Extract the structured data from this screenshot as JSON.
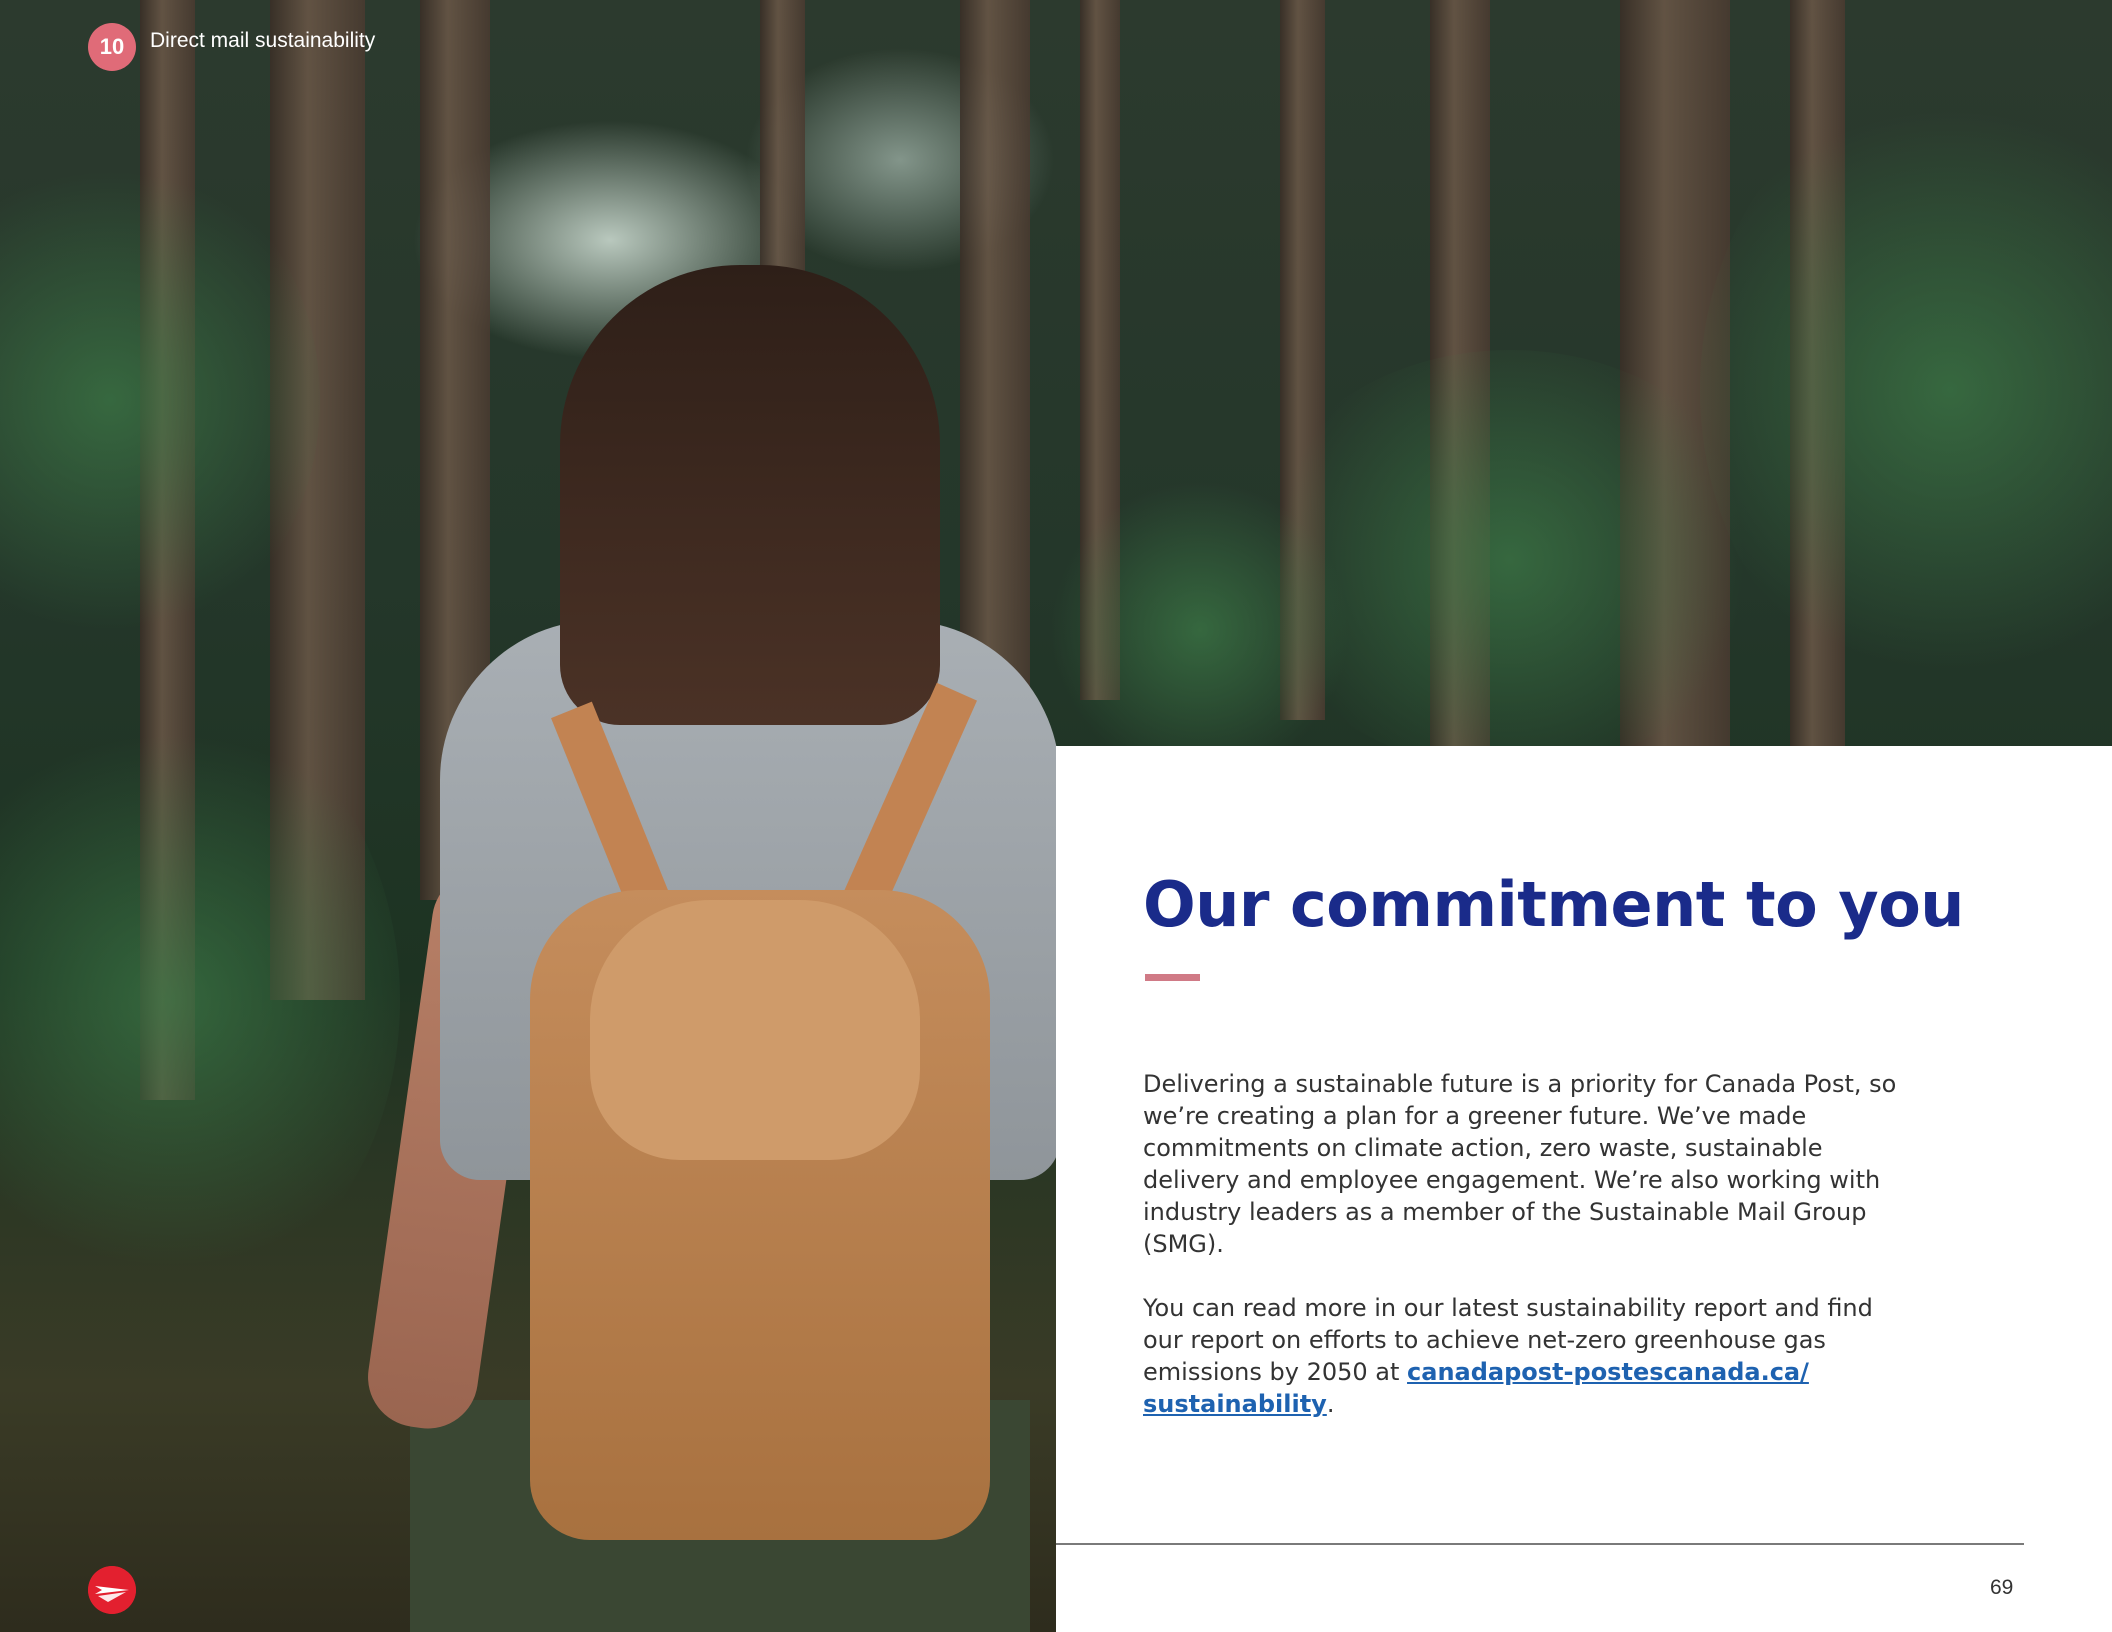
{
  "header": {
    "chapter_number": "10",
    "section_title": "Direct mail sustainability"
  },
  "main": {
    "title": "Our commitment to you",
    "paragraph_1": "Delivering a sustainable future is a priority for Canada Post, so we’re creating a plan for a greener future. We’ve made commitments on climate action, zero waste, sustainable delivery and employee engagement. We’re also working with industry leaders as a member of the Sustainable Mail Group (SMG).",
    "paragraph_2_before_link": "You can read more in our latest sustainability report and find our report on efforts to achieve net-zero greenhouse gas emissions by 2050 at ",
    "link_text_line1": "canadapost-postescanada.ca/",
    "link_text_line2": "sustainability",
    "paragraph_2_after_link": "."
  },
  "footer": {
    "page_number": "69",
    "logo_icon": "canada-post-logo-icon"
  },
  "colors": {
    "title": "#1a2b8a",
    "accent": "#d07a86",
    "link": "#1e62b0",
    "badge": "#e06b78",
    "logo": "#e3202f"
  }
}
